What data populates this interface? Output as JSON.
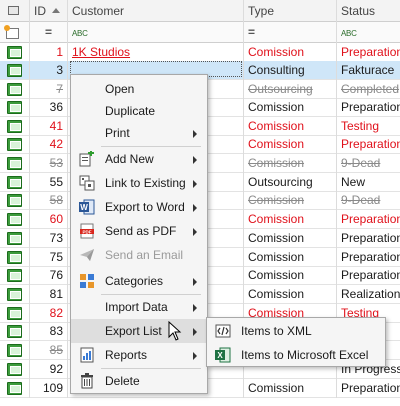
{
  "columns": {
    "id": "ID",
    "customer": "Customer",
    "type": "Type",
    "status": "Status"
  },
  "filter": {
    "eq": "=",
    "abc": "ABC"
  },
  "rows": [
    {
      "id": "1",
      "customer": "1K Studios",
      "type": "Comission",
      "status": "Preparation"
    },
    {
      "id": "3",
      "customer": "",
      "type": "Consulting",
      "status": "Fakturace"
    },
    {
      "id": "7",
      "customer": "",
      "type": "Outsourcing",
      "status": "Completed"
    },
    {
      "id": "36",
      "customer": "",
      "type": "Comission",
      "status": "Preparation"
    },
    {
      "id": "41",
      "customer": "",
      "type": "Comission",
      "status": "Testing"
    },
    {
      "id": "42",
      "customer": "",
      "type": "Comission",
      "status": "Preparation"
    },
    {
      "id": "53",
      "customer": "",
      "type": "Comission",
      "status": "9-Dead"
    },
    {
      "id": "55",
      "customer": "",
      "type": "Outsourcing",
      "status": "New"
    },
    {
      "id": "58",
      "customer": "",
      "type": "Comission",
      "status": "9-Dead"
    },
    {
      "id": "60",
      "customer": "",
      "type": "Comission",
      "status": "Preparation"
    },
    {
      "id": "73",
      "customer": "",
      "type": "Comission",
      "status": "Preparation"
    },
    {
      "id": "75",
      "customer": "",
      "type": "Comission",
      "status": "Preparation"
    },
    {
      "id": "76",
      "customer": "",
      "type": "Comission",
      "status": "Preparation"
    },
    {
      "id": "81",
      "customer": "",
      "type": "Comission",
      "status": "Realization"
    },
    {
      "id": "82",
      "customer": "",
      "type": "Comission",
      "status": "Testing"
    },
    {
      "id": "83",
      "customer": "",
      "type": "",
      "status": ""
    },
    {
      "id": "85",
      "customer": "",
      "type": "",
      "status": "ed"
    },
    {
      "id": "92",
      "customer": "",
      "type": "",
      "status": "In Progress"
    },
    {
      "id": "109",
      "customer": "",
      "type": "Comission",
      "status": "Preparation"
    }
  ],
  "context_menu": {
    "items": [
      {
        "label": "Open",
        "icon": "none"
      },
      {
        "label": "Duplicate",
        "icon": "none"
      },
      {
        "label": "Print",
        "icon": "none",
        "submenu": true
      },
      {
        "label": "Add New",
        "icon": "add-new-icon",
        "submenu": true
      },
      {
        "label": "Link to Existing",
        "icon": "link-icon",
        "submenu": true
      },
      {
        "label": "Export to Word",
        "icon": "word-icon",
        "submenu": true
      },
      {
        "label": "Send as PDF",
        "icon": "pdf-icon",
        "submenu": true
      },
      {
        "label": "Send an Email",
        "icon": "email-icon",
        "disabled": true
      },
      {
        "label": "Categories",
        "icon": "categories-icon",
        "submenu": true
      },
      {
        "label": "Import Data",
        "icon": "none",
        "submenu": true
      },
      {
        "label": "Export List",
        "icon": "none",
        "submenu": true,
        "highlighted": true
      },
      {
        "label": "Reports",
        "icon": "reports-icon",
        "submenu": true
      },
      {
        "label": "Delete",
        "icon": "trash-icon"
      }
    ]
  },
  "export_submenu": {
    "items": [
      {
        "label": "Items to XML",
        "icon": "xml-icon"
      },
      {
        "label": "Items to Microsoft Excel",
        "icon": "excel-icon"
      }
    ]
  },
  "colors": {
    "selected_row": "#cfe6f8",
    "alert_red": "#e0101a",
    "menu_bg": "#f5f5f5"
  }
}
